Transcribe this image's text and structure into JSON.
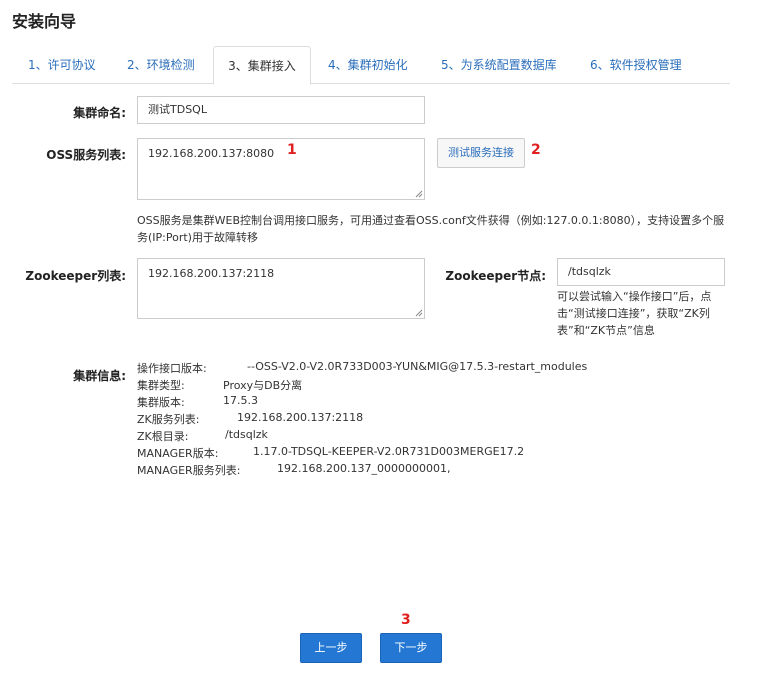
{
  "page": {
    "title": "安装向导"
  },
  "tabs": [
    {
      "label": "1、许可协议"
    },
    {
      "label": "2、环境检测"
    },
    {
      "label": "3、集群接入"
    },
    {
      "label": "4、集群初始化"
    },
    {
      "label": "5、为系统配置数据库"
    },
    {
      "label": "6、软件授权管理"
    }
  ],
  "form": {
    "cluster_name": {
      "label": "集群命名:",
      "value": "测试TDSQL"
    },
    "oss_list": {
      "label": "OSS服务列表:",
      "value": "192.168.200.137:8080",
      "help": "OSS服务是集群WEB控制台调用接口服务，可用通过查看OSS.conf文件获得（例如:127.0.0.1:8080），支持设置多个服务(IP:Port)用于故障转移"
    },
    "test_button": "测试服务连接",
    "zookeeper_list": {
      "label": "Zookeeper列表:",
      "value": "192.168.200.137:2118"
    },
    "zookeeper_node": {
      "label": "Zookeeper节点:",
      "value": "/tdsqlzk",
      "help": "可以尝试输入“操作接口”后，点击“测试接口连接”，获取“ZK列表”和“ZK节点”信息"
    }
  },
  "cluster_info": {
    "label": "集群信息:",
    "rows": [
      {
        "key": "操作接口版本:",
        "value": "--OSS-V2.0-V2.0R733D003-YUN&MIG@17.5.3-restart_modules"
      },
      {
        "key": "集群类型:",
        "value": "Proxy与DB分离"
      },
      {
        "key": "集群版本:",
        "value": "17.5.3"
      },
      {
        "key": "ZK服务列表:",
        "value": "192.168.200.137:2118"
      },
      {
        "key": "ZK根目录:",
        "value": "/tdsqlzk"
      },
      {
        "key": "MANAGER版本:",
        "value": "1.17.0-TDSQL-KEEPER-V2.0R731D003MERGE17.2"
      },
      {
        "key": "MANAGER服务列表:",
        "value": "192.168.200.137_0000000001,"
      }
    ]
  },
  "markers": {
    "m1": "1",
    "m2": "2",
    "m3": "3"
  },
  "footer": {
    "prev": "上一步",
    "next": "下一步"
  }
}
